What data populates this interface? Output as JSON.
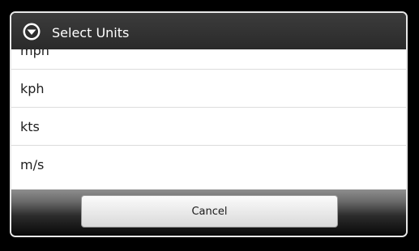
{
  "dialog": {
    "title": "Select Units",
    "title_icon": "chevron-down-circle-icon"
  },
  "units": [
    {
      "label": "mph"
    },
    {
      "label": "kph"
    },
    {
      "label": "kts"
    },
    {
      "label": "m/s"
    }
  ],
  "buttons": {
    "cancel_label": "Cancel"
  },
  "colors": {
    "title_bar": "#333333",
    "list_background": "#ffffff",
    "list_text": "#1e1e1e",
    "divider": "#dcdcdc",
    "dialog_border": "#e8e8e8"
  }
}
